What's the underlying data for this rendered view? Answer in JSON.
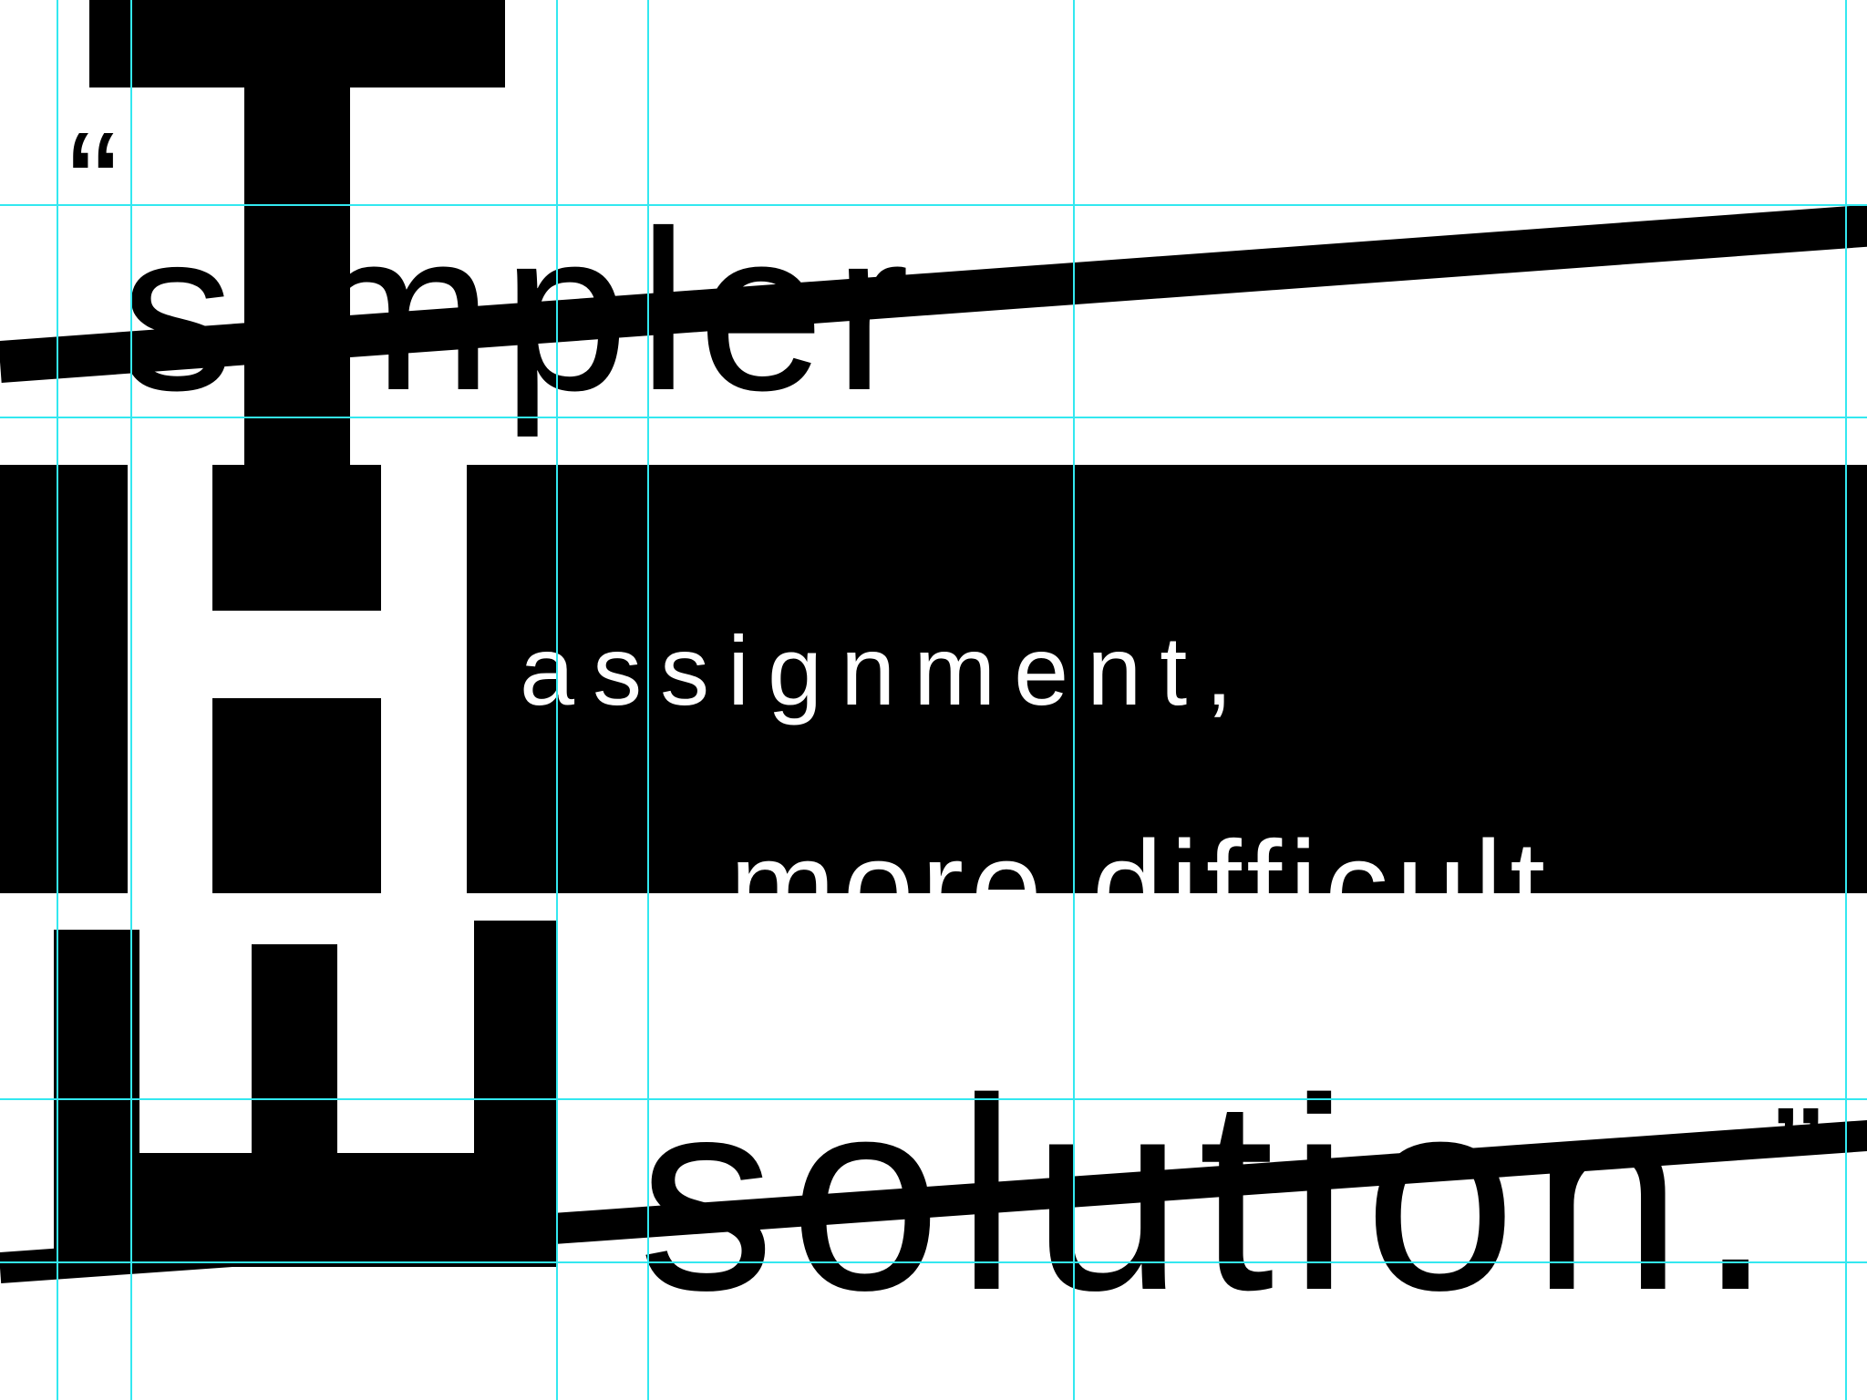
{
  "poster": {
    "open_quote": "“",
    "close_quote": "”",
    "word_simpler": "simpler",
    "word_assignment": "assignment,",
    "word_more_difficult": "more difficult",
    "word_solution": "solution."
  },
  "colors": {
    "ink": "#000000",
    "paper": "#ffffff",
    "guides": "#33e8f0"
  }
}
